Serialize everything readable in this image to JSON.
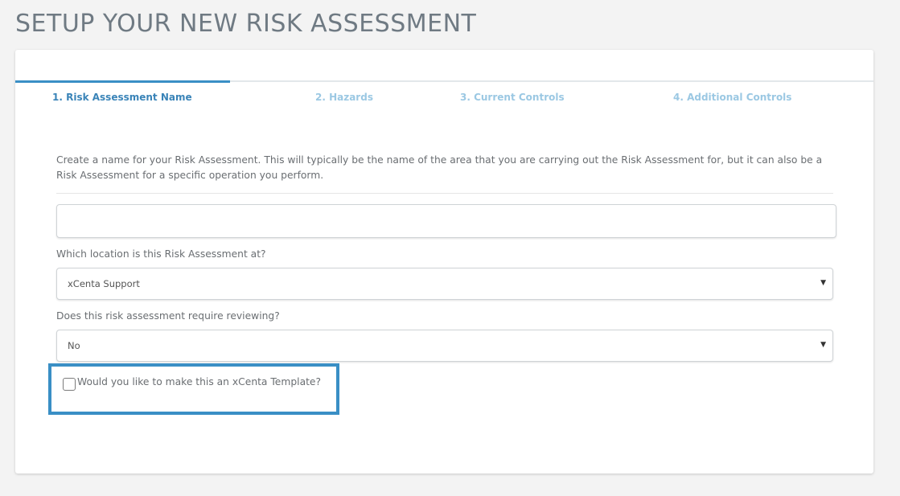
{
  "page": {
    "title": "SETUP YOUR NEW RISK ASSESSMENT"
  },
  "tabs": [
    {
      "label": "1. Risk Assessment Name",
      "active": true
    },
    {
      "label": "2. Hazards",
      "active": false
    },
    {
      "label": "3. Current Controls",
      "active": false
    },
    {
      "label": "4. Additional Controls",
      "active": false
    }
  ],
  "form": {
    "intro": "Create a name for your Risk Assessment. This will typically be the name of the area that you are carrying out the Risk Assessment for, but it can also be a Risk Assessment for a specific operation you perform.",
    "name_input": {
      "value": "",
      "placeholder": ""
    },
    "location": {
      "label": "Which location is this Risk Assessment at?",
      "selected": "xCenta Support"
    },
    "review": {
      "label": "Does this risk assessment require reviewing?",
      "selected": "No"
    },
    "template": {
      "label": "Would you like to make this an xCenta Template?",
      "checked": false
    }
  },
  "colors": {
    "accent": "#3a8fc5",
    "tab_active": "#3a84b8",
    "tab_inactive": "#9bc8e3",
    "title": "#6f7a83",
    "background": "#f3f3f3"
  },
  "icons": {
    "select_caret": "caret-down-icon"
  }
}
